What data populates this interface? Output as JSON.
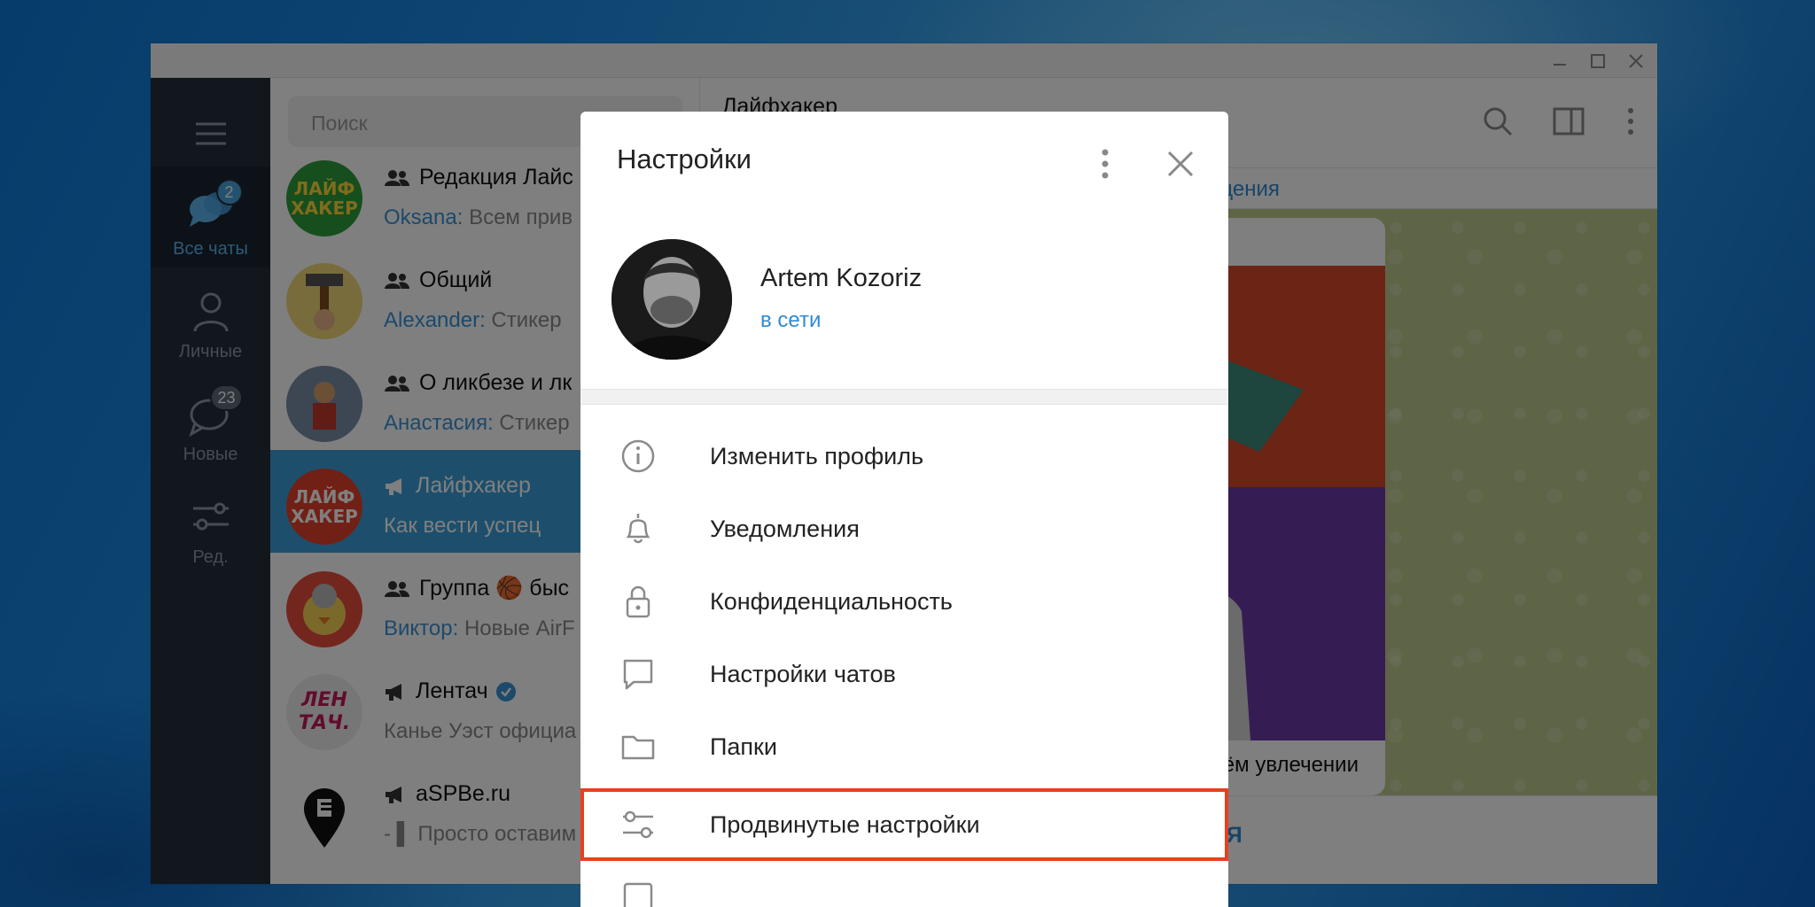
{
  "window": {
    "controls": [
      {
        "name": "minimize-button",
        "icon": "minimize-icon"
      },
      {
        "name": "maximize-button",
        "icon": "maximize-icon"
      },
      {
        "name": "close-window-button",
        "icon": "close-icon"
      }
    ]
  },
  "sidebar": {
    "menu_icon": "hamburger-icon",
    "folders": [
      {
        "label": "Все чаты",
        "badge": "2",
        "icon": "chats-icon",
        "active": true
      },
      {
        "label": "Личные",
        "badge": "",
        "icon": "person-icon",
        "active": false
      },
      {
        "label": "Новые",
        "badge": "23",
        "icon": "chat-bubble-icon",
        "active": false
      },
      {
        "label": "Ред.",
        "badge": "",
        "icon": "sliders-icon",
        "active": false
      }
    ]
  },
  "chatlist": {
    "search_placeholder": "Поиск",
    "chats": [
      {
        "avatar_text": "ЛАЙФ ХАКЕР",
        "type": "group",
        "name": "Редакция Лайс",
        "sender": "Oksana:",
        "snippet": "Всем прив",
        "active": false
      },
      {
        "avatar_text": "",
        "type": "group",
        "name": "Общий",
        "sender": "Alexander:",
        "snippet": "Стикер",
        "active": false
      },
      {
        "avatar_text": "",
        "type": "group",
        "name": "О ликбезе и лк",
        "sender": "Анастасия:",
        "snippet": "Стикер",
        "active": false
      },
      {
        "avatar_text": "ЛАЙФ ХАКЕР",
        "type": "channel",
        "name": "Лайфхакер",
        "sender": "",
        "snippet": "Как вести успец",
        "active": true
      },
      {
        "avatar_text": "",
        "type": "group",
        "name": "Группа 🏀 быс",
        "sender": "Виктор:",
        "snippet": "Новые AirF",
        "active": false
      },
      {
        "avatar_text": "ЛЕН ТАЧ.",
        "type": "channel",
        "name": "Лентач",
        "sender": "",
        "snippet": "Канье Уэст официа",
        "active": false,
        "verified": true
      },
      {
        "avatar_text": "",
        "type": "channel",
        "name": "aSPBe.ru",
        "sender": "",
        "snippet": "- ▌ Просто оставим",
        "active": false
      }
    ]
  },
  "chatpane": {
    "title": "Лайфхакер",
    "pinned_text": "ообщения",
    "caption": "оём увлечении",
    "bottom_text": "ЕНИЯ",
    "icons": [
      "search-icon",
      "sidebar-toggle-icon",
      "more-vertical-icon"
    ]
  },
  "modal": {
    "title": "Настройки",
    "profile": {
      "name": "Artem Kozoriz",
      "status": "в сети"
    },
    "items": [
      {
        "label": "Изменить профиль",
        "icon": "info-icon"
      },
      {
        "label": "Уведомления",
        "icon": "bell-icon"
      },
      {
        "label": "Конфиденциальность",
        "icon": "lock-icon"
      },
      {
        "label": "Настройки чатов",
        "icon": "chat-icon"
      },
      {
        "label": "Папки",
        "icon": "folder-icon"
      },
      {
        "label": "Продвинутые настройки",
        "icon": "sliders-icon",
        "highlighted": true
      }
    ]
  },
  "colors": {
    "accent": "#2f8bd1",
    "highlight_border": "#e8401f",
    "sidebar_bg": "#222e3a",
    "active_chat": "#3a9fd8"
  }
}
